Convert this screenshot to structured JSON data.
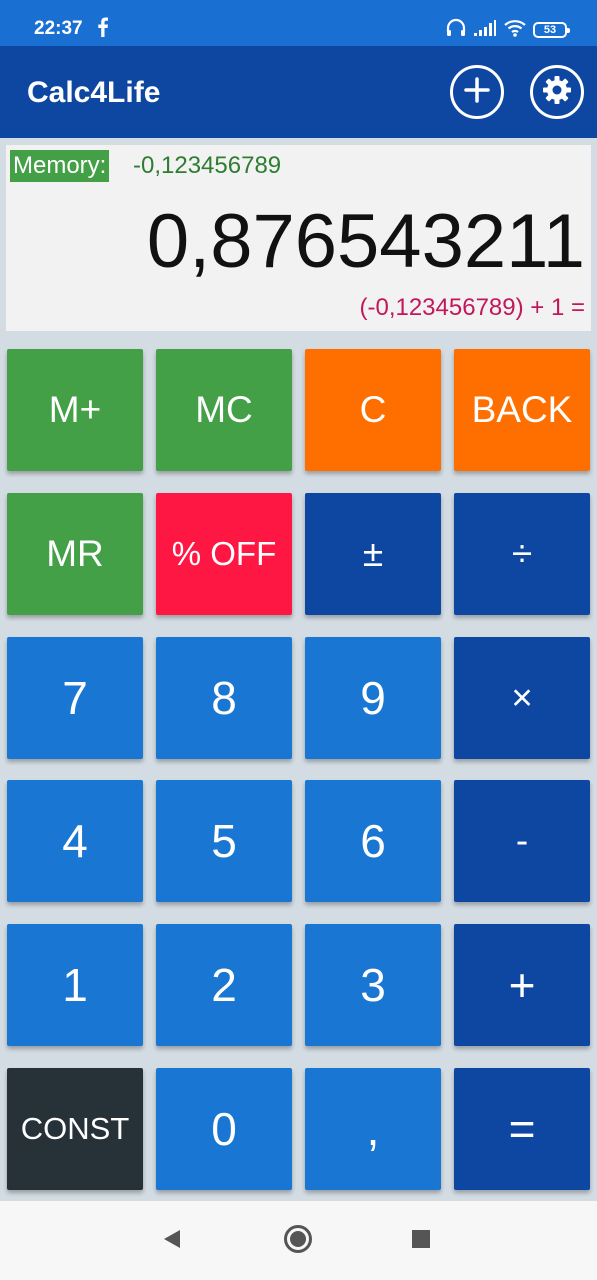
{
  "status_bar": {
    "time": "22:37",
    "battery": "53",
    "icons": [
      "facebook-icon",
      "headphones-icon",
      "signal-icon",
      "wifi-icon",
      "battery-icon"
    ]
  },
  "app_bar": {
    "title": "Calc4Life",
    "actions": [
      "add-circle-icon",
      "gear-icon"
    ]
  },
  "display": {
    "memory_label": "Memory:",
    "memory_value": "-0,123456789",
    "main_value": "0,876543211",
    "expression": "(-0,123456789) + 1 ="
  },
  "keypad": {
    "m_plus": "M+",
    "mc": "MC",
    "c": "C",
    "back": "BACK",
    "mr": "MR",
    "percent_off": "% OFF",
    "plus_minus": "±",
    "divide": "÷",
    "seven": "7",
    "eight": "8",
    "nine": "9",
    "multiply": "×",
    "four": "4",
    "five": "5",
    "six": "6",
    "minus": "-",
    "one": "1",
    "two": "2",
    "three": "3",
    "plus": "+",
    "const": "CONST",
    "zero": "0",
    "comma": ",",
    "equals": "="
  },
  "nav_bar": {
    "icons": [
      "back-triangle-icon",
      "home-circle-icon",
      "recents-square-icon"
    ]
  },
  "colors": {
    "status_bar": "#1a6fd3",
    "app_bar": "#0d47a1",
    "green": "#43a047",
    "orange": "#ff6f00",
    "red": "#ff1744",
    "blue": "#1976d2",
    "dark_blue": "#0d47a1",
    "charcoal": "#263238",
    "memory_text": "#2e7d32",
    "expression_text": "#c2185b"
  }
}
